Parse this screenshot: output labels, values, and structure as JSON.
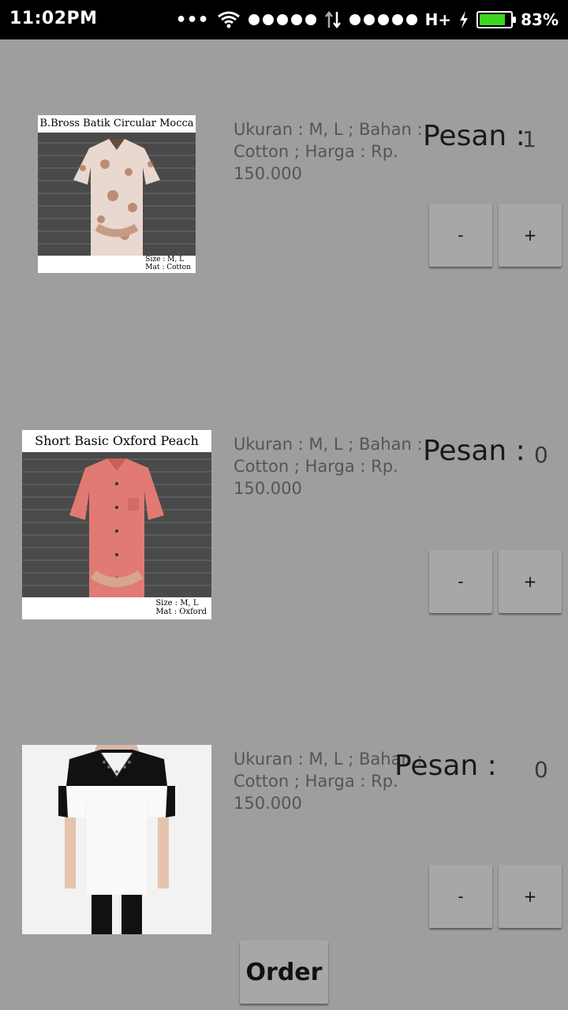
{
  "status_bar": {
    "time": "11:02PM",
    "network": "H+",
    "battery_percent": "83%",
    "battery_level": 0.83,
    "battery_color": "#3ed61e"
  },
  "products": [
    {
      "image_title": "B.Bross Batik Circular Mocca",
      "image_caption_size": "Size : M, L",
      "image_caption_mat": "Mat : Cotton",
      "description": "Ukuran : M, L ; Bahan : Cotton ; Harga : Rp. 150.000",
      "pesan_label": "Pesan :",
      "quantity": "1",
      "minus_label": "-",
      "plus_label": "+"
    },
    {
      "image_title": "Short Basic Oxford Peach",
      "image_caption_size": "Size : M, L",
      "image_caption_mat": "Mat : Oxford",
      "description": "Ukuran : M, L ; Bahan : Cotton ; Harga : Rp. 150.000",
      "pesan_label": "Pesan :",
      "quantity": "0",
      "minus_label": "-",
      "plus_label": "+"
    },
    {
      "description": "Ukuran : M, L ; Bahan : Cotton ; Harga : Rp. 150.000",
      "pesan_label": "Pesan :",
      "quantity": "0",
      "minus_label": "-",
      "plus_label": "+"
    }
  ],
  "order_label": "Order"
}
